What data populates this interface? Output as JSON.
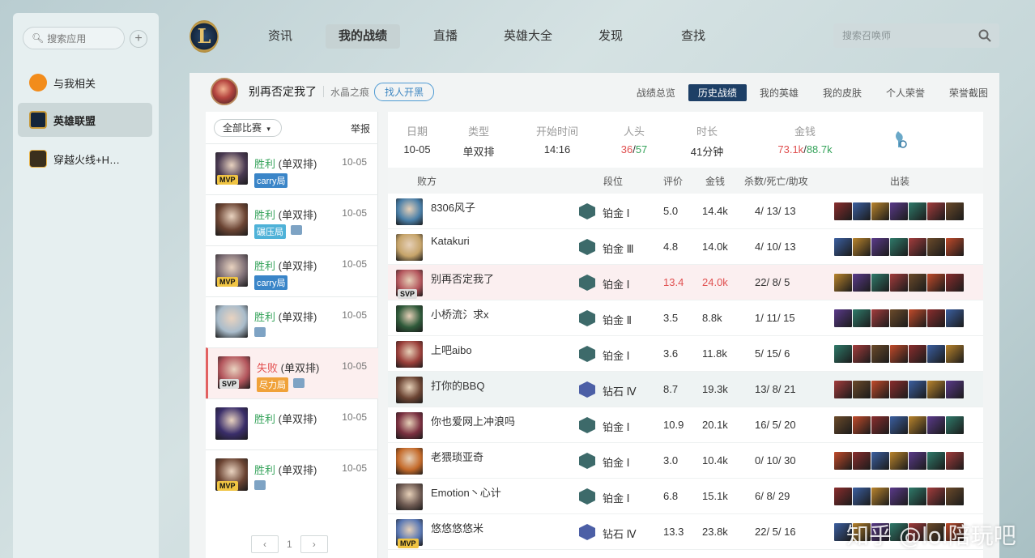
{
  "sidebar": {
    "search_placeholder": "搜索应用",
    "plus": "+",
    "items": [
      {
        "label": "与我相关",
        "color": "#f28c1b"
      },
      {
        "label": "英雄联盟",
        "color": "#c89b3c"
      },
      {
        "label": "穿越火线+H…",
        "color": "#3a2f1d"
      }
    ]
  },
  "logo": {
    "glyph": "L"
  },
  "topnav": [
    "资讯",
    "我的战绩",
    "直播",
    "英雄大全",
    "发现",
    "查找"
  ],
  "top_search_placeholder": "搜索召唤师",
  "header": {
    "name": "别再否定我了",
    "server": "水晶之痕",
    "pill": "找人开黑",
    "tabs": [
      "战绩总览",
      "历史战绩",
      "我的英雄",
      "我的皮肤",
      "个人荣誉",
      "荣誉截图"
    ]
  },
  "matches": {
    "filter": "全部比赛",
    "report": "举报",
    "items": [
      {
        "result": "胜利",
        "mode": "(单双排)",
        "date": "10-05",
        "badge": "MVP",
        "tag": "carry局",
        "tag_color": "#3a85c8",
        "win": true,
        "img": false,
        "color": "#4a3a52"
      },
      {
        "result": "胜利",
        "mode": "(单双排)",
        "date": "10-05",
        "badge": "",
        "tag": "碾压局",
        "tag_color": "#4fb2d8",
        "win": true,
        "img": true,
        "color": "#6b4433"
      },
      {
        "result": "胜利",
        "mode": "(单双排)",
        "date": "10-05",
        "badge": "MVP",
        "tag": "carry局",
        "tag_color": "#3a85c8",
        "win": true,
        "img": false,
        "color": "#7d6e75"
      },
      {
        "result": "胜利",
        "mode": "(单双排)",
        "date": "10-05",
        "badge": "",
        "tag": "",
        "tag_color": "",
        "win": true,
        "img": true,
        "color": "#a9bccb"
      },
      {
        "result": "失败",
        "mode": "(单双排)",
        "date": "10-05",
        "badge": "SVP",
        "tag": "尽力局",
        "tag_color": "#f0a23a",
        "win": false,
        "img": true,
        "color": "#b3555c"
      },
      {
        "result": "胜利",
        "mode": "(单双排)",
        "date": "10-05",
        "badge": "",
        "tag": "",
        "tag_color": "",
        "win": true,
        "img": false,
        "color": "#3a2e6a"
      },
      {
        "result": "胜利",
        "mode": "(单双排)",
        "date": "10-05",
        "badge": "MVP",
        "tag": "",
        "tag_color": "",
        "win": true,
        "img": true,
        "color": "#6b4433"
      }
    ],
    "page": "1"
  },
  "summary": {
    "date_h": "日期",
    "date": "10-05",
    "type_h": "类型",
    "type": "单双排",
    "start_h": "开始时间",
    "start": "14:16",
    "kills_h": "人头",
    "kills_a": "36",
    "kills_b": "57",
    "dur_h": "时长",
    "dur": "41分钟",
    "gold_h": "金钱",
    "gold_a": "73.1k",
    "gold_b": "88.7k"
  },
  "table": {
    "head": {
      "side": "败方",
      "tier": "段位",
      "score": "评价",
      "gold": "金钱",
      "kda": "杀数/死亡/助攻",
      "items": "出装"
    },
    "rows": [
      {
        "name": "8306风子",
        "tier": "铂金 Ⅰ",
        "score": "5.0",
        "gold": "14.4k",
        "kda": "4/ 13/ 13",
        "tier_color": "#3d6a6a",
        "color": "#4a7fa8"
      },
      {
        "name": "Katakuri",
        "tier": "铂金 Ⅲ",
        "score": "4.8",
        "gold": "14.0k",
        "kda": "4/ 10/ 13",
        "tier_color": "#3d6a6a",
        "color": "#c6a46a"
      },
      {
        "name": "别再否定我了",
        "tier": "铂金 Ⅰ",
        "score": "13.4",
        "gold": "24.0k",
        "kda": "22/ 8/ 5",
        "tier_color": "#3d6a6a",
        "color": "#b3555c",
        "me": true,
        "badge": "SVP"
      },
      {
        "name": "小桥流氵求x",
        "tier": "铂金 Ⅱ",
        "score": "3.5",
        "gold": "8.8k",
        "kda": "1/ 11/ 15",
        "tier_color": "#3d6a6a",
        "color": "#2f5a3a"
      },
      {
        "name": "上吧aibo",
        "tier": "铂金 Ⅰ",
        "score": "3.6",
        "gold": "11.8k",
        "kda": "5/ 15/ 6",
        "tier_color": "#3d6a6a",
        "color": "#9a3f3a"
      },
      {
        "name": "打你的BBQ",
        "tier": "钻石 Ⅳ",
        "score": "8.7",
        "gold": "19.3k",
        "kda": "13/ 8/ 21",
        "tier_color": "#4c5fa6",
        "color": "#6b4433",
        "hl": true
      },
      {
        "name": "你也爱网上冲浪吗",
        "tier": "铂金 Ⅰ",
        "score": "10.9",
        "gold": "20.1k",
        "kda": "16/ 5/ 20",
        "tier_color": "#3d6a6a",
        "color": "#7a3040"
      },
      {
        "name": "老猥琐亚奇",
        "tier": "铂金 Ⅰ",
        "score": "3.0",
        "gold": "10.4k",
        "kda": "0/ 10/ 30",
        "tier_color": "#3d6a6a",
        "color": "#c46a2a"
      },
      {
        "name": "Emotion丶心计",
        "tier": "铂金 Ⅰ",
        "score": "6.8",
        "gold": "15.1k",
        "kda": "6/ 8/ 29",
        "tier_color": "#3d6a6a",
        "color": "#6e5a52"
      },
      {
        "name": "悠悠悠悠米",
        "tier": "钻石 Ⅳ",
        "score": "13.3",
        "gold": "23.8k",
        "kda": "22/ 5/ 16",
        "tier_color": "#4c5fa6",
        "color": "#5a78b4",
        "badge": "MVP"
      }
    ]
  },
  "watermark": "知乎 @lol陪玩吧"
}
